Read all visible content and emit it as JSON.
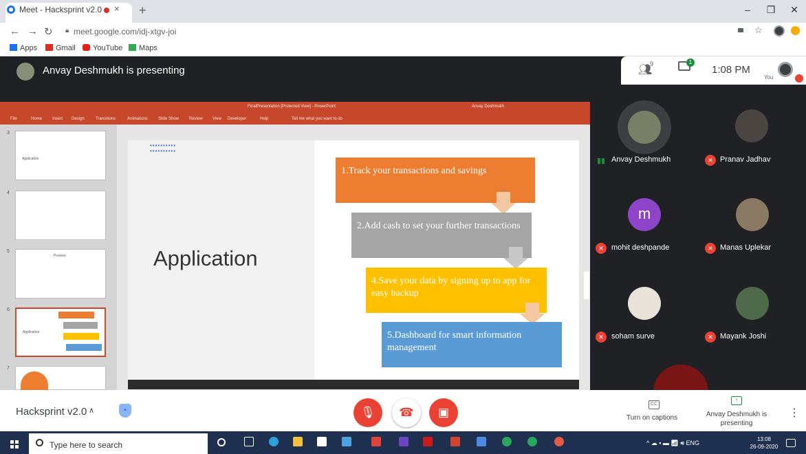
{
  "browser": {
    "tab_title": "Meet - Hacksprint v2.0",
    "tab_close": "×",
    "new_tab": "+",
    "url": "meet.google.com/idj-xtgv-joi",
    "bookmarks": [
      "Apps",
      "Gmail",
      "YouTube",
      "Maps"
    ],
    "window_minimize": "–",
    "window_restore": "❐",
    "window_close": "✕"
  },
  "meet": {
    "presenting_title": "Anvay Deshmukh is presenting",
    "clock": "1:08 PM",
    "people_count": "9",
    "chat_badge": "1",
    "you_label": "You",
    "participants": [
      {
        "name": "Anvay Deshmukh",
        "muted": false
      },
      {
        "name": "Pranav Jadhav",
        "muted": true
      },
      {
        "name": "mohit deshpande",
        "muted": true,
        "initial": "m"
      },
      {
        "name": "Manas Uplekar",
        "muted": true
      },
      {
        "name": "soham surve",
        "muted": true
      },
      {
        "name": "Mayank Joshi",
        "muted": true
      }
    ],
    "meeting_name": "Hacksprint v2.0",
    "captions_label": "Turn on captions",
    "present_label": "Anvay Deshmukh is presenting"
  },
  "ppt": {
    "doc_title": "FinalPresentation [Protected View] - PowerPoint",
    "user": "Anvay Deshmukh",
    "ribbon_tabs": [
      "File",
      "Home",
      "Insert",
      "Design",
      "Transitions",
      "Animations",
      "Slide Show",
      "Review",
      "View",
      "Developer",
      "Help"
    ],
    "tell_me": "Tell me what you want to do",
    "thumb_numbers": [
      "3",
      "4",
      "5",
      "6",
      "7"
    ],
    "thumb_texts": [
      "Application",
      "Preview"
    ],
    "slide": {
      "heading": "Application",
      "steps": [
        {
          "text": "1.Track your transactions and savings",
          "color": "#ed7d31"
        },
        {
          "text": "2.Add cash to set your further transactions",
          "color": "#a5a5a5"
        },
        {
          "text": "4.Save your data by signing up to app for easy backup",
          "color": "#ffc000"
        },
        {
          "text": "5.Dashboard for smart information management",
          "color": "#5b9bd5"
        }
      ]
    }
  },
  "taskbar": {
    "search_placeholder": "Type here to search",
    "tray_lang": "ENG",
    "time": "13:08",
    "date": "26-09-2020"
  }
}
